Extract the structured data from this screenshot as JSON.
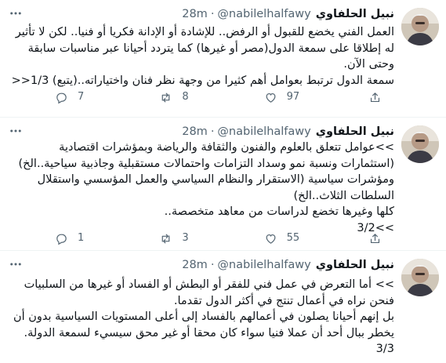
{
  "tweets": [
    {
      "name": "نبيل الحلفاوي",
      "handle": "@nabilelhalfawy",
      "separator": "·",
      "time": "28m",
      "text": "العمل الفني يخضع للقبول أو الرفض.. للإشادة أو الإدانة فكريا أو فنيا.. لكن لا تأثير له إطلاقا على سمعة الدول(مصر أو غيرها) كما يتردد أحيانا عبر مناسبات سابقة وحتى الآن.\nسمعة الدول ترتبط بعوامل أهم كثيرا من وجهة نظر فنان واختياراته..(يتبع) 1/3<<",
      "replies": "7",
      "retweets": "8",
      "likes": "97",
      "share": ""
    },
    {
      "name": "نبيل الحلفاوي",
      "handle": "@nabilelhalfawy",
      "separator": "·",
      "time": "28m",
      "text": ">>عوامل تتعلق بالعلوم والفنون والثقافة والرياضة وبمؤشرات اقتصادية (استثمارات ونسبة نمو وسداد التزامات واحتمالات مستقبلية وجاذبية سياحية..الخ)\nومؤشرات سياسية (الاستقرار والنظام السياسي والعمل المؤسسي واستقلال السلطات الثلاث..الخ)\nكلها وغيرها تخضع لدراسات من معاهد متخصصة..\n>>3/2",
      "replies": "1",
      "retweets": "3",
      "likes": "55",
      "share": ""
    },
    {
      "name": "نبيل الحلفاوي",
      "handle": "@nabilelhalfawy",
      "separator": "·",
      "time": "28m",
      "text": ">> أما التعرض في عمل فني للفقر أو البطش أو الفساد أو غيرها من السلبيات فنحن نراه في أعمال تنتج في أكثر الدول تقدما.\nبل إنهم أحيانا يصلون في أعمالهم بالفساد إلى أعلى المستويات السياسية بدون أن يخطر ببال أحد أن عملا فنيا سواء كان محقا أو غير محق سيسيء لسمعة الدولة. 3/3",
      "replies": "",
      "retweets": "",
      "likes": "",
      "share": ""
    }
  ],
  "icons": {
    "reply": "reply-icon",
    "retweet": "retweet-icon",
    "like": "heart-icon",
    "share": "share-icon",
    "more": "more-icon"
  },
  "colors": {
    "text": "#0f1419",
    "secondary": "#536471",
    "divider": "#eff3f4"
  }
}
